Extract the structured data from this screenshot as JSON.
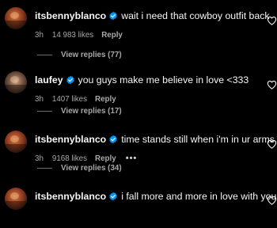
{
  "comments": [
    {
      "username": "itsbennyblanco",
      "text": "wait i need that cowboy outfit back",
      "time": "3h",
      "likes": "14 983 likes",
      "reply": "Reply",
      "view_replies": "View replies (77)",
      "avatar_icon": "profile-photo"
    },
    {
      "username": "laufey",
      "text": "you guys make me believe in love <333",
      "time": "3h",
      "likes": "1407 likes",
      "reply": "Reply",
      "view_replies": "View replies (17)",
      "avatar_icon": "profile-photo"
    },
    {
      "username": "itsbennyblanco",
      "text": "time stands still when i'm in ur arms",
      "time": "3h",
      "likes": "9168 likes",
      "reply": "Reply",
      "more": "•••",
      "view_replies": "View replies (34)",
      "avatar_icon": "profile-photo"
    },
    {
      "username": "itsbennyblanco",
      "text": "i fall more and more in love with you",
      "avatar_icon": "profile-photo"
    }
  ],
  "icons": {
    "verified": "verified-badge",
    "like": "heart-outline"
  },
  "colors": {
    "background": "#000000",
    "primary_text": "#f5f5f5",
    "secondary_text": "#a8a8a8",
    "verified_blue": "#0095f6"
  }
}
